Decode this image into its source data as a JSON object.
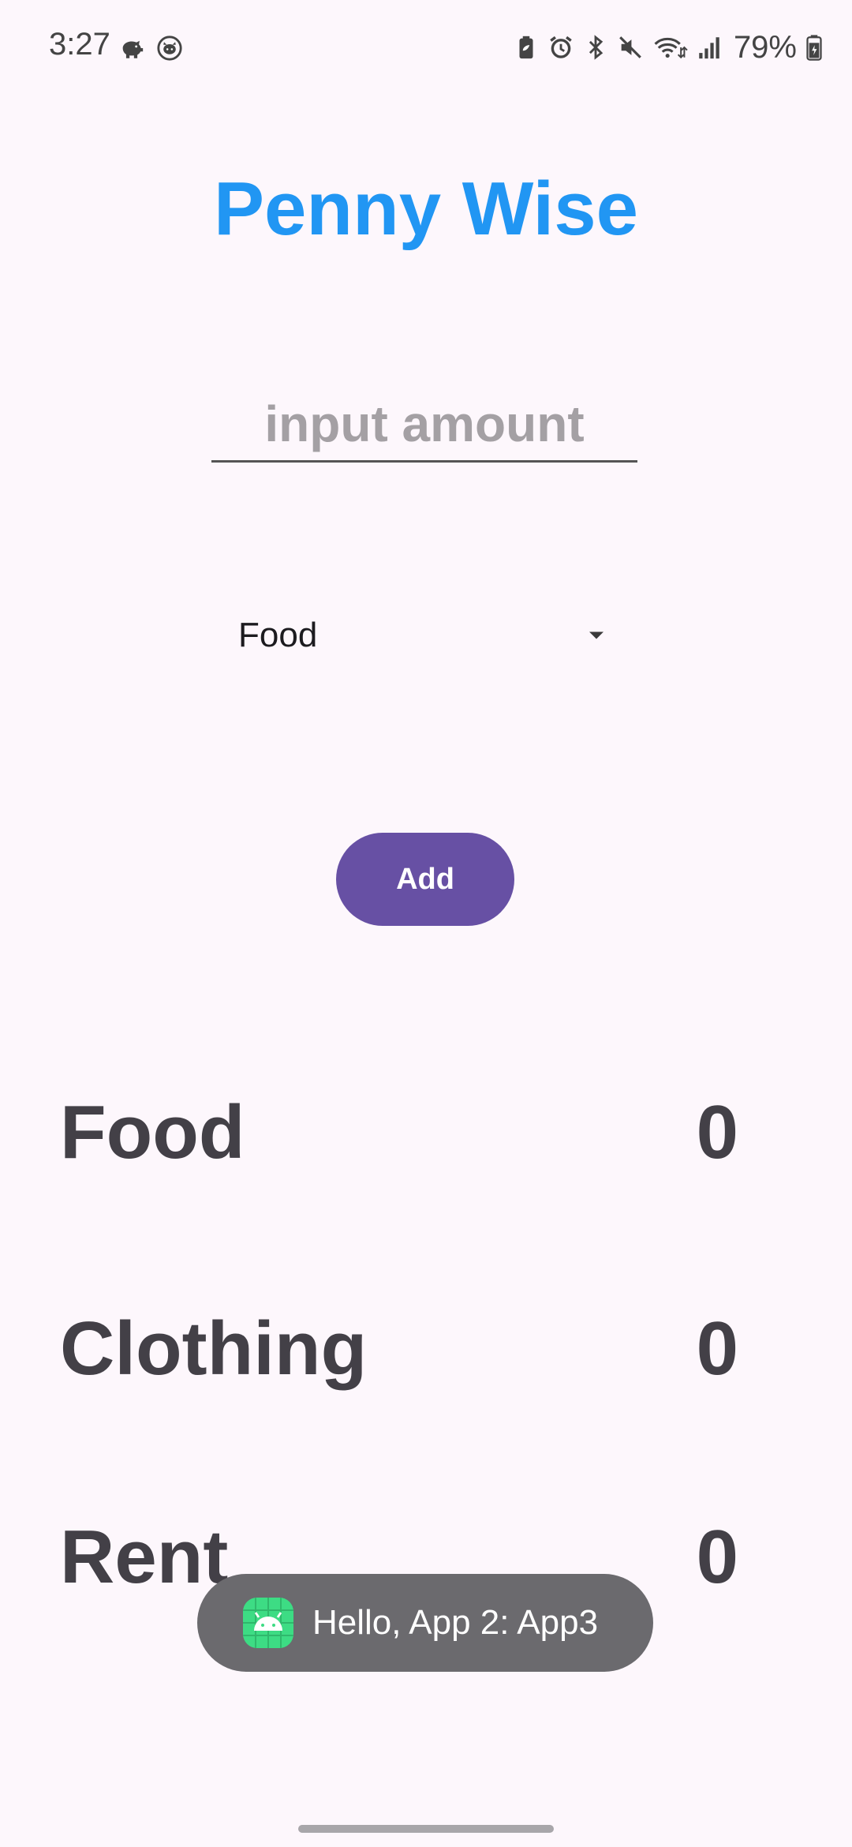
{
  "status_bar": {
    "time": "3:27",
    "battery_percent": "79%",
    "left_icons": [
      "piggy-bank-icon",
      "cat-face-icon"
    ],
    "right_icons": [
      "battery-saver-icon",
      "alarm-icon",
      "bluetooth-icon",
      "mute-icon",
      "wifi-icon",
      "signal-icon",
      "battery-icon"
    ]
  },
  "app": {
    "title": "Penny Wise",
    "amount_input": {
      "value": "",
      "placeholder": "input amount"
    },
    "category_select": {
      "selected": "Food"
    },
    "add_button_label": "Add",
    "totals": [
      {
        "label": "Food",
        "value": "0"
      },
      {
        "label": "Clothing",
        "value": "0"
      },
      {
        "label": "Rent",
        "value": "0"
      }
    ]
  },
  "toast": {
    "text": "Hello, App 2: App3"
  },
  "colors": {
    "background": "#fdf7fc",
    "title": "#2196f3",
    "button": "#6750a4",
    "totals_text": "#434047",
    "toast_bg": "#6b6a6e",
    "app_icon": "#3ddc84"
  }
}
